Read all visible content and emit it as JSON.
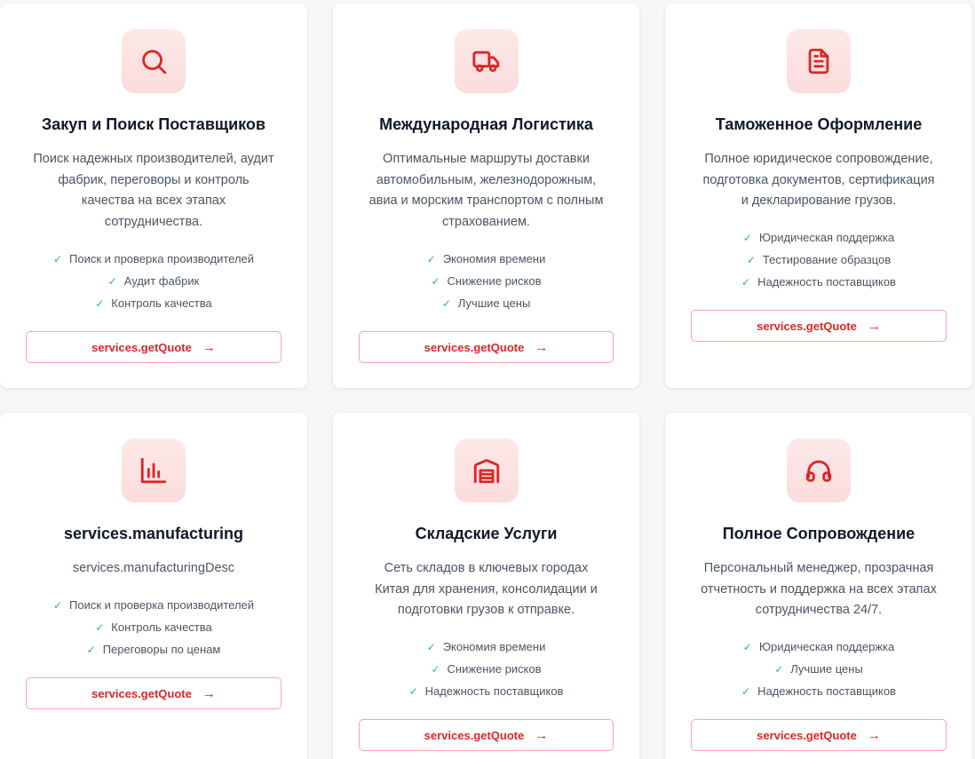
{
  "cards": [
    {
      "icon": "search-icon",
      "title": "Закуп и Поиск Поставщиков",
      "desc_lines": [
        "Поиск надежных производителей, аудит",
        "фабрик, переговоры и контроль",
        "качества на всех этапах",
        "сотрудничества."
      ],
      "features": [
        "Поиск и проверка производителей",
        "Аудит фабрик",
        "Контроль качества"
      ],
      "cta": "services.getQuote"
    },
    {
      "icon": "truck-icon",
      "title": "Международная Логистика",
      "desc_lines": [
        "Оптимальные маршруты доставки",
        "автомобильным, железнодорожным,",
        "авиа и морским транспортом с полным",
        "страхованием."
      ],
      "features": [
        "Экономия времени",
        "Снижение рисков",
        "Лучшие цены"
      ],
      "cta": "services.getQuote"
    },
    {
      "icon": "document-icon",
      "title": "Таможенное Оформление",
      "desc_lines": [
        "Полное юридическое сопровождение,",
        "подготовка документов, сертификация",
        "и декларирование грузов."
      ],
      "features": [
        "Юридическая поддержка",
        "Тестирование образцов",
        "Надежность поставщиков"
      ],
      "cta": "services.getQuote"
    },
    {
      "icon": "bar-chart-icon",
      "title": "services.manufacturing",
      "desc_lines": [
        "services.manufacturingDesc"
      ],
      "features": [
        "Поиск и проверка производителей",
        "Контроль качества",
        "Переговоры по ценам"
      ],
      "cta": "services.getQuote"
    },
    {
      "icon": "warehouse-icon",
      "title": "Складские Услуги",
      "desc_lines": [
        "Сеть складов в ключевых городах",
        "Китая для хранения, консолидации и",
        "подготовки грузов к отправке."
      ],
      "features": [
        "Экономия времени",
        "Снижение рисков",
        "Надежность поставщиков"
      ],
      "cta": "services.getQuote"
    },
    {
      "icon": "headphones-icon",
      "title": "Полное Сопровождение",
      "desc_lines": [
        "Персональный менеджер, прозрачная",
        "отчетность и поддержка на всех этапах",
        "сотрудничества 24/7."
      ],
      "features": [
        "Юридическая поддержка",
        "Лучшие цены",
        "Надежность поставщиков"
      ],
      "cta": "services.getQuote"
    }
  ],
  "colors": {
    "accent": "#dc2626",
    "check": "#22c55e",
    "icon_bg": "#fde2e2"
  }
}
